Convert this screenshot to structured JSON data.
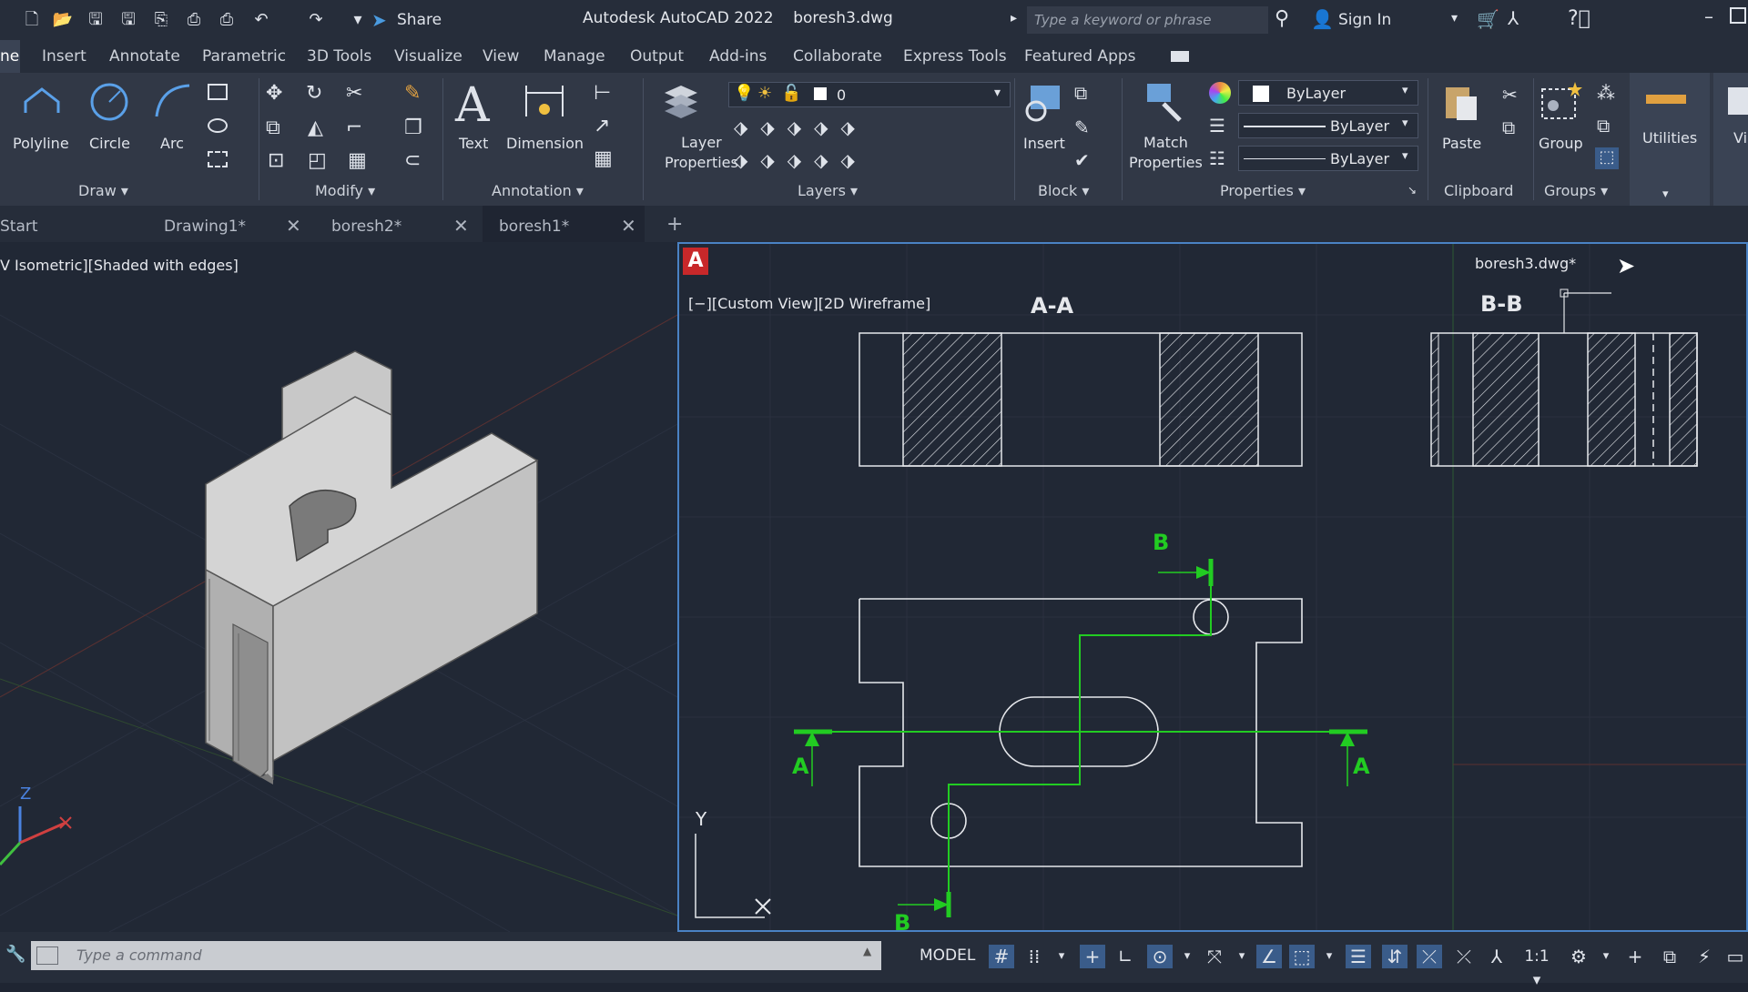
{
  "quick_access": {
    "share_label": "Share"
  },
  "title": {
    "app": "Autodesk AutoCAD 2022",
    "file": "boresh3.dwg"
  },
  "search": {
    "placeholder": "Type a keyword or phrase"
  },
  "account": {
    "sign_in": "Sign In"
  },
  "menu": [
    "ne",
    "Insert",
    "Annotate",
    "Parametric",
    "3D Tools",
    "Visualize",
    "View",
    "Manage",
    "Output",
    "Add-ins",
    "Collaborate",
    "Express Tools",
    "Featured Apps"
  ],
  "ribbon": {
    "draw": {
      "polyline": "Polyline",
      "circle": "Circle",
      "arc": "Arc",
      "title": "Draw"
    },
    "modify": {
      "title": "Modify"
    },
    "annotation": {
      "text": "Text",
      "dimension": "Dimension",
      "title": "Annotation"
    },
    "layers": {
      "layer_properties": [
        "Layer",
        "Properties"
      ],
      "current_layer": "0",
      "title": "Layers"
    },
    "block": {
      "insert": "Insert",
      "title": "Block"
    },
    "properties": {
      "match": [
        "Match",
        "Properties"
      ],
      "color": "ByLayer",
      "linetype": "ByLayer",
      "lineweight": "ByLayer",
      "title": "Properties"
    },
    "clipboard": {
      "paste": "Paste",
      "title": "Clipboard"
    },
    "groups": {
      "group": "Group",
      "title": "Groups"
    },
    "utilities": {
      "label": "Utilities"
    },
    "view": {
      "label": "Vi"
    }
  },
  "tabs": [
    {
      "label": "Start"
    },
    {
      "label": "Drawing1*"
    },
    {
      "label": "boresh2*"
    },
    {
      "label": "boresh1*"
    }
  ],
  "viewport_left": {
    "label": "V Isometric][Shaded with edges]"
  },
  "viewport_right": {
    "label": "[−][Custom View][2D Wireframe]",
    "file": "boresh3.dwg*",
    "section_aa": "A-A",
    "section_bb": "B-B",
    "marker_a": "A",
    "marker_b": "B",
    "axis_x": "X",
    "axis_y": "Y"
  },
  "ucs_left": {
    "z": "Z"
  },
  "command": {
    "placeholder": "Type a command"
  },
  "status": {
    "model": "MODEL",
    "scale": "1:1"
  },
  "colors": {
    "accent": "#4a82c4",
    "section_line": "#22cc22",
    "background": "#212835"
  }
}
